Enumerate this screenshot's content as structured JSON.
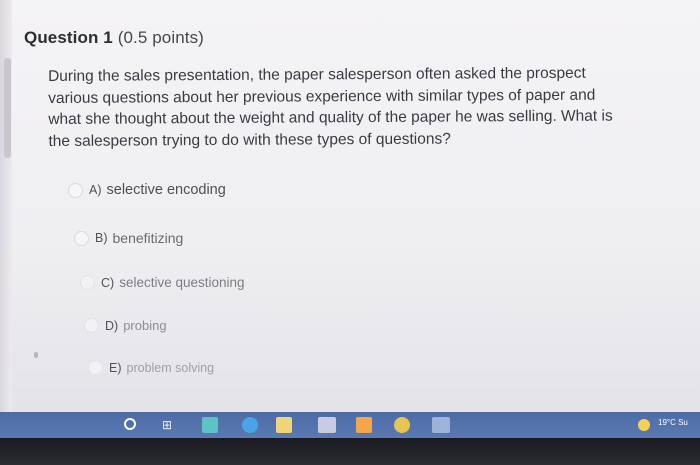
{
  "question": {
    "number_label": "Question 1",
    "points_label": "(0.5 points)",
    "lines": [
      "During the sales presentation, the paper salesperson often asked the prospect",
      "various questions about her previous experience with similar types of paper and",
      "what she thought about the weight and quality of the paper he was selling. What is",
      "the salesperson trying to do with these types of questions?"
    ]
  },
  "options": [
    {
      "letter": "A)",
      "label": "selective encoding"
    },
    {
      "letter": "B)",
      "label": "benefitizing"
    },
    {
      "letter": "C)",
      "label": "selective questioning"
    },
    {
      "letter": "D)",
      "label": "probing"
    },
    {
      "letter": "E)",
      "label": "problem solving"
    }
  ],
  "taskbar": {
    "task_view_glyph": "⊞",
    "weather_text": "19°C Su",
    "icons": [
      "start-icon",
      "task-view-icon",
      "store-icon",
      "edge-icon",
      "folder-icon",
      "calendar-icon",
      "photos-icon",
      "chrome-icon",
      "app-icon"
    ]
  },
  "colors": {
    "taskbar": "#5a78b2",
    "text": "#3a3a44",
    "bezel": "#1f2025"
  }
}
